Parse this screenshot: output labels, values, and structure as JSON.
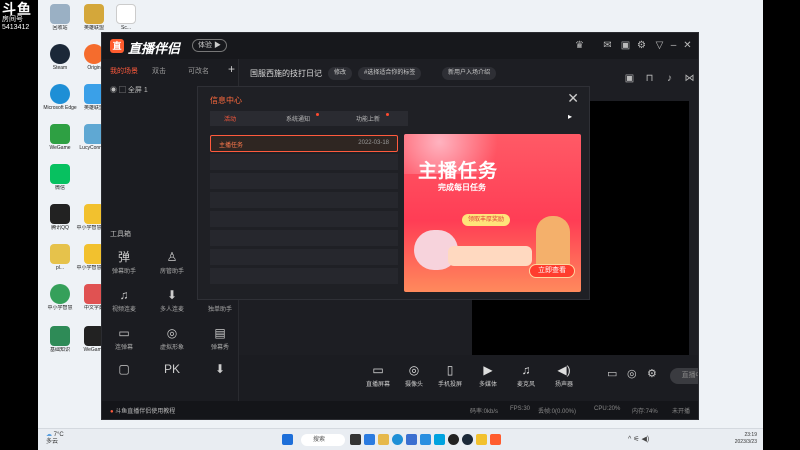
{
  "watermark": {
    "logo": "斗鱼",
    "sub": "房间号",
    "room": "5413412"
  },
  "desktop_icons": [
    {
      "label": "回收站",
      "color": "#9ab0c4"
    },
    {
      "label": "英雄联盟",
      "color": "#d4a73a"
    },
    {
      "label": "Sc...",
      "color": "#ffffff"
    },
    {
      "label": "Steam",
      "color": "#1b2838"
    },
    {
      "label": "Origin",
      "color": "#f56c2d"
    },
    {
      "label": "Microsoft Edge",
      "color": "#1e8fd6"
    },
    {
      "label": "英雄联盟",
      "color": "#3aa0e8"
    },
    {
      "label": "WeGame",
      "color": "#2ea043"
    },
    {
      "label": "LucyConnect",
      "color": "#5fa8d3"
    },
    {
      "label": "微信",
      "color": "#07c160"
    },
    {
      "label": "腾讯QQ",
      "color": "#222222"
    },
    {
      "label": "中小学智慧教育",
      "color": "#f2c12e"
    },
    {
      "label": "pl...",
      "color": "#e6c24b"
    },
    {
      "label": "中小学智慧教育",
      "color": "#f2c12e"
    },
    {
      "label": "中小学智慧",
      "color": "#35a05a"
    },
    {
      "label": "中文字典",
      "color": "#e05252"
    },
    {
      "label": "基础知识",
      "color": "#2e8b57"
    },
    {
      "label": "WeGame",
      "color": "#222222"
    }
  ],
  "app": {
    "name": "直播伴侣",
    "logo_glyph": "直",
    "version_label": "体验 ▶",
    "left_tabs": [
      "我的场景",
      "双击",
      "可改名"
    ],
    "scene_item": "全屏 1",
    "toolbox_label": "工具箱",
    "tools": [
      {
        "icon": "弹",
        "label": "弹幕助手"
      },
      {
        "icon": "♙",
        "label": "房管助手"
      },
      {
        "icon": "♫",
        "label": "视频连麦"
      },
      {
        "icon": "⬇",
        "label": "多人连麦"
      },
      {
        "icon": "⬇",
        "label": "独单助手"
      },
      {
        "icon": "▭",
        "label": "连弹幕"
      },
      {
        "icon": "◎",
        "label": "虚拟形象"
      },
      {
        "icon": "▤",
        "label": "弹幕秀"
      },
      {
        "icon": "▢",
        "label": ""
      },
      {
        "icon": "PK",
        "label": ""
      },
      {
        "icon": "⬇",
        "label": ""
      }
    ],
    "stream_title": "国服西施的技打日记",
    "modify_label": "修改",
    "tag_placeholder": "#选择适合你的标签",
    "new_user_label": "新用户入场介绍",
    "bottom_items": [
      {
        "icon": "▭",
        "label": "直播屏幕"
      },
      {
        "icon": "◎",
        "label": "摄像头"
      },
      {
        "icon": "▯",
        "label": "手机投屏"
      },
      {
        "icon": "▶",
        "label": "多媒体"
      },
      {
        "icon": "♫",
        "label": "麦克风"
      },
      {
        "icon": "◀)",
        "label": "扬声器"
      }
    ],
    "go_live_label": "直播中...",
    "tutorial_link": "斗鱼直播伴侣使用教程",
    "status": {
      "bitrate": "码率:0kb/s",
      "fps": "FPS:30",
      "drop": "丢帧:0(0.00%)",
      "cpu": "CPU:20%",
      "mem": "内存:74%",
      "net": "未开播"
    }
  },
  "dialog": {
    "title": "信息中心",
    "close_glyph": "✕",
    "tabs": [
      {
        "label": "活动",
        "active": true,
        "dot": false
      },
      {
        "label": "系统通知",
        "active": false,
        "dot": true
      },
      {
        "label": "功能上新",
        "active": false,
        "dot": true
      }
    ],
    "messages": [
      {
        "title": "主播任务",
        "date": "2022-03-18"
      },
      {
        "title": "",
        "date": ""
      },
      {
        "title": "",
        "date": ""
      },
      {
        "title": "",
        "date": ""
      },
      {
        "title": "",
        "date": ""
      },
      {
        "title": "",
        "date": ""
      },
      {
        "title": "",
        "date": ""
      },
      {
        "title": "",
        "date": ""
      }
    ],
    "banner": {
      "title": "主播任务",
      "subtitle": "完成每日任务",
      "chip": "领取丰厚奖励",
      "button": "立即查看"
    }
  },
  "taskbar": {
    "weather_temp": "7°C",
    "weather_desc": "多云",
    "search_label": "搜索",
    "clock_time": "23:19",
    "clock_date": "2023/3/23"
  }
}
